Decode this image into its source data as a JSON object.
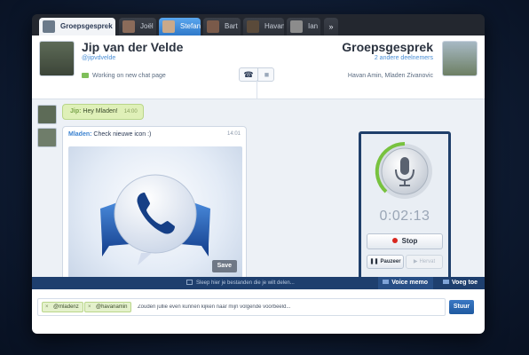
{
  "tabs": [
    {
      "label": "Groepsgesprek",
      "close": "×"
    },
    {
      "label": "Joël"
    },
    {
      "label": "Stefan"
    },
    {
      "label": "Bart"
    },
    {
      "label": "Havan"
    },
    {
      "label": "Ian"
    },
    {
      "label": "»"
    }
  ],
  "contact": {
    "name": "Jip van der Velde",
    "handle": "@jipvdvelde",
    "status": "Working on new chat page"
  },
  "call_buttons": {
    "phone": "☎",
    "video": "■"
  },
  "group": {
    "title": "Groepsgesprek",
    "subtitle": "2 andere deelnemers",
    "members": "Havan Amin, Mladen Zivanovic"
  },
  "messages": [
    {
      "sender": "Jip:",
      "text": "Hey Mladen!",
      "time": "14:00"
    },
    {
      "sender": "Mladen:",
      "text": "Check nieuwe icon :)",
      "time": "14:01",
      "attachment_button": "Save"
    }
  ],
  "voice_memo": {
    "timer": "0:02:13",
    "stop_label": "Stop",
    "pause_label": "Pauzeer",
    "resume_label": "Hervat"
  },
  "dropbar": {
    "text": "Sleep hier je bestanden die je wilt delen...",
    "voice_memo_label": "Voice memo",
    "add_label": "Voeg toe"
  },
  "compose": {
    "tags": [
      "@mladenz",
      "@havanamin"
    ],
    "text": "Zouden jullie even kunnen kijken naar mijn volgende voorbeeld...",
    "send_label": "Stuur"
  },
  "colors": {
    "accent": "#1f3f6a",
    "link": "#4a8fd6",
    "message_green": "#dff0b8",
    "record": "#d8261e"
  }
}
